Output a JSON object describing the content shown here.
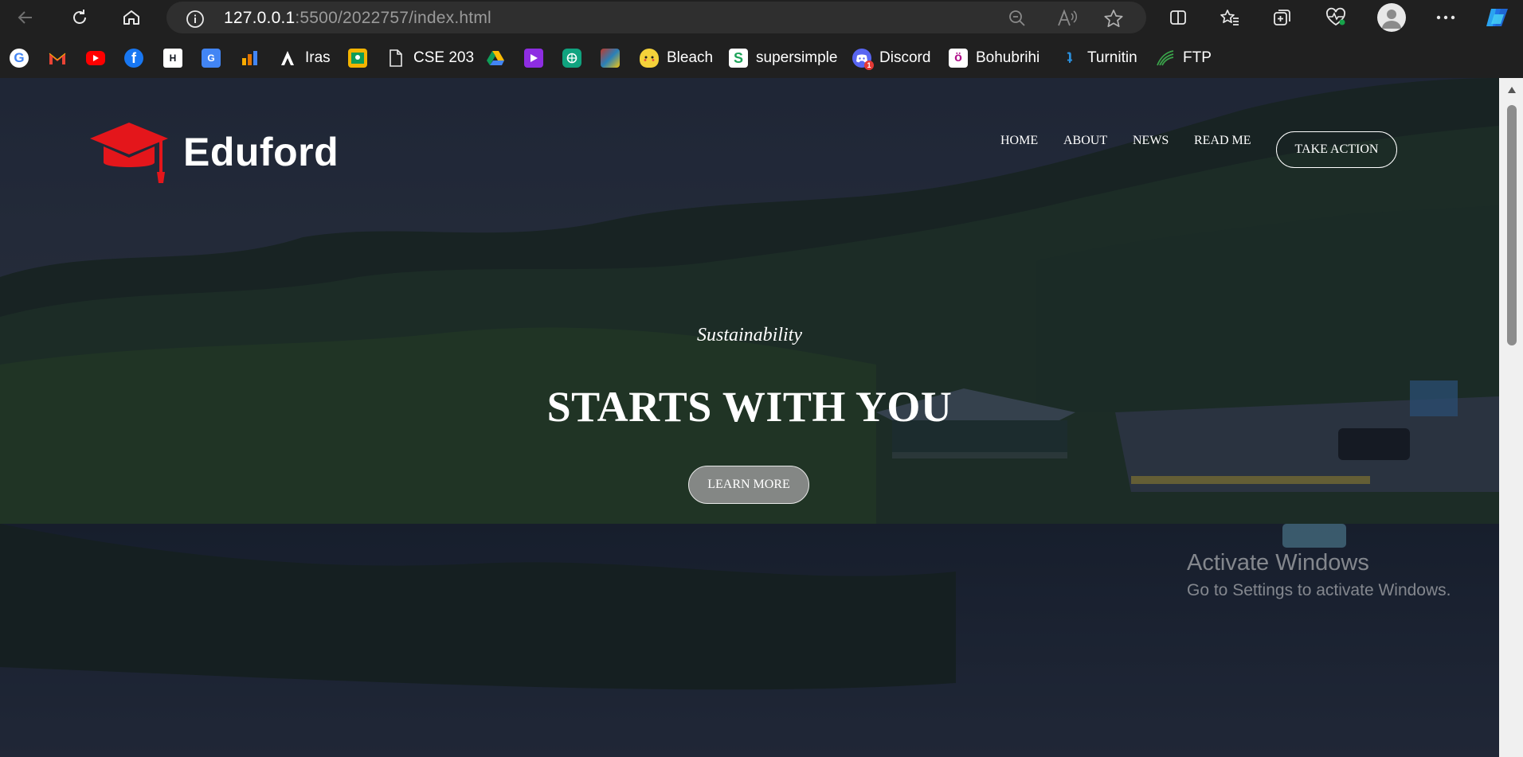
{
  "browser": {
    "url_host": "127.0.0.1",
    "url_rest": ":5500/2022757/index.html"
  },
  "bookmarks": [
    {
      "label": "",
      "icon": "google-icon"
    },
    {
      "label": "",
      "icon": "gmail-icon"
    },
    {
      "label": "",
      "icon": "youtube-icon"
    },
    {
      "label": "",
      "icon": "facebook-icon"
    },
    {
      "label": "",
      "icon": "hackerrank-icon"
    },
    {
      "label": "",
      "icon": "translate-icon"
    },
    {
      "label": "",
      "icon": "analytics-icon"
    },
    {
      "label": "Iras",
      "icon": "iras-icon"
    },
    {
      "label": "",
      "icon": "classroom-icon"
    },
    {
      "label": "CSE 203",
      "icon": "page-icon"
    },
    {
      "label": "",
      "icon": "drive-icon"
    },
    {
      "label": "",
      "icon": "media-icon"
    },
    {
      "label": "",
      "icon": "chatgpt-icon"
    },
    {
      "label": "",
      "icon": "photo-icon"
    },
    {
      "label": "Bleach",
      "icon": "pikachu-icon"
    },
    {
      "label": "supersimple",
      "icon": "supersimple-icon"
    },
    {
      "label": "Discord",
      "icon": "discord-icon"
    },
    {
      "label": "Bohubrihi",
      "icon": "bohubrihi-icon"
    },
    {
      "label": "Turnitin",
      "icon": "turnitin-icon"
    },
    {
      "label": "FTP",
      "icon": "ftp-icon"
    }
  ],
  "site": {
    "brand": "Eduford",
    "nav": [
      "HOME",
      "ABOUT",
      "NEWS",
      "READ ME"
    ],
    "cta": "TAKE ACTION",
    "kicker": "Sustainability",
    "headline": "STARTS WITH YOU",
    "button": "LEARN MORE",
    "brand_color": "#e4161b"
  },
  "watermark": {
    "title": "Activate Windows",
    "subtitle": "Go to Settings to activate Windows."
  }
}
